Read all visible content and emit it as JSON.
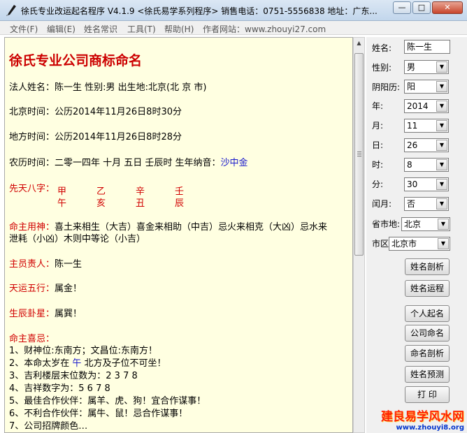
{
  "window": {
    "title": "徐氏专业改运起名程序 V4.1.9 <徐氏易学系列程序>    销售电话：0751-5556838    地址：广东...",
    "buttons": {
      "minimize": "—",
      "maximize": "□",
      "close": "✕"
    }
  },
  "menu": [
    "文件(F)",
    "编辑(E)",
    "姓名常识",
    "工具(T)",
    "帮助(H)",
    "作者网站：www.zhouyi27.com"
  ],
  "content": {
    "heading": "徐氏专业公司商标命名",
    "legal": "法人姓名：陈一生  性别:男   出生地:北京(北 京 市)",
    "beijing_time": "北京时间：公历2014年11月26日8时30分",
    "local_time": "地方时间：公历2014年11月26日8时28分",
    "lunar_label": "农历时间：二零一四年  十月  五日  壬辰时     生年纳音：",
    "lunar_nayin": "沙中金",
    "bazi_label": "先天八字：",
    "bazi_top": [
      "甲",
      "乙",
      "辛",
      "壬"
    ],
    "bazi_bottom": [
      "午",
      "亥",
      "丑",
      "辰"
    ],
    "yongshen_label": "命主用神：",
    "yongshen_1": "喜土来相生（大吉）喜金来相助（中吉）忌火来相克（大凶）忌水来",
    "yongshen_2": "泄耗（小凶）木则中等论（小吉）",
    "owner_label": "主员责人：",
    "owner_value": "陈一生",
    "wuxing_label": "天运五行：",
    "wuxing_value": "属金！",
    "gua_label": "生辰卦星：",
    "gua_value": "属巽！",
    "likes_label": "命主喜忌：",
    "items": [
      "1、财神位:东南方；文昌位:东南方！",
      "2、本命太岁在 ",
      "3、吉利楼层末位数为：2 3 7 8",
      "4、吉祥数字为：5 6 7 8",
      "5、最佳合作伙伴：属羊、虎、狗！宜合作谋事！",
      "6、不利合作伙伴：属牛、鼠！忌合作谋事！",
      "7、公司招牌颜色…"
    ],
    "taisui_zhi": "午",
    "taisui_rest": " 北方及子位不可坐！"
  },
  "panel": {
    "name_label": "姓名:",
    "name_value": "陈一生",
    "gender_label": "性别:",
    "gender_value": "男",
    "calendar_label": "阴阳历:",
    "calendar_value": "阳",
    "year_label": "年:",
    "year_value": "2014",
    "month_label": "月:",
    "month_value": "11",
    "day_label": "日:",
    "day_value": "26",
    "hour_label": "时:",
    "hour_value": "8",
    "minute_label": "分:",
    "minute_value": "30",
    "leap_label": "闰月:",
    "leap_value": "否",
    "province_label": "省市地:",
    "province_value": "北京",
    "city_label": "市区",
    "city_value": "北京市",
    "buttons": [
      "姓名剖析",
      "姓名运程",
      "个人起名",
      "公司命名",
      "命名剖析",
      "姓名预测",
      "打 印"
    ]
  },
  "watermark": {
    "line1": "建良易学风水网",
    "line2": "www.zhouyi8.org"
  }
}
